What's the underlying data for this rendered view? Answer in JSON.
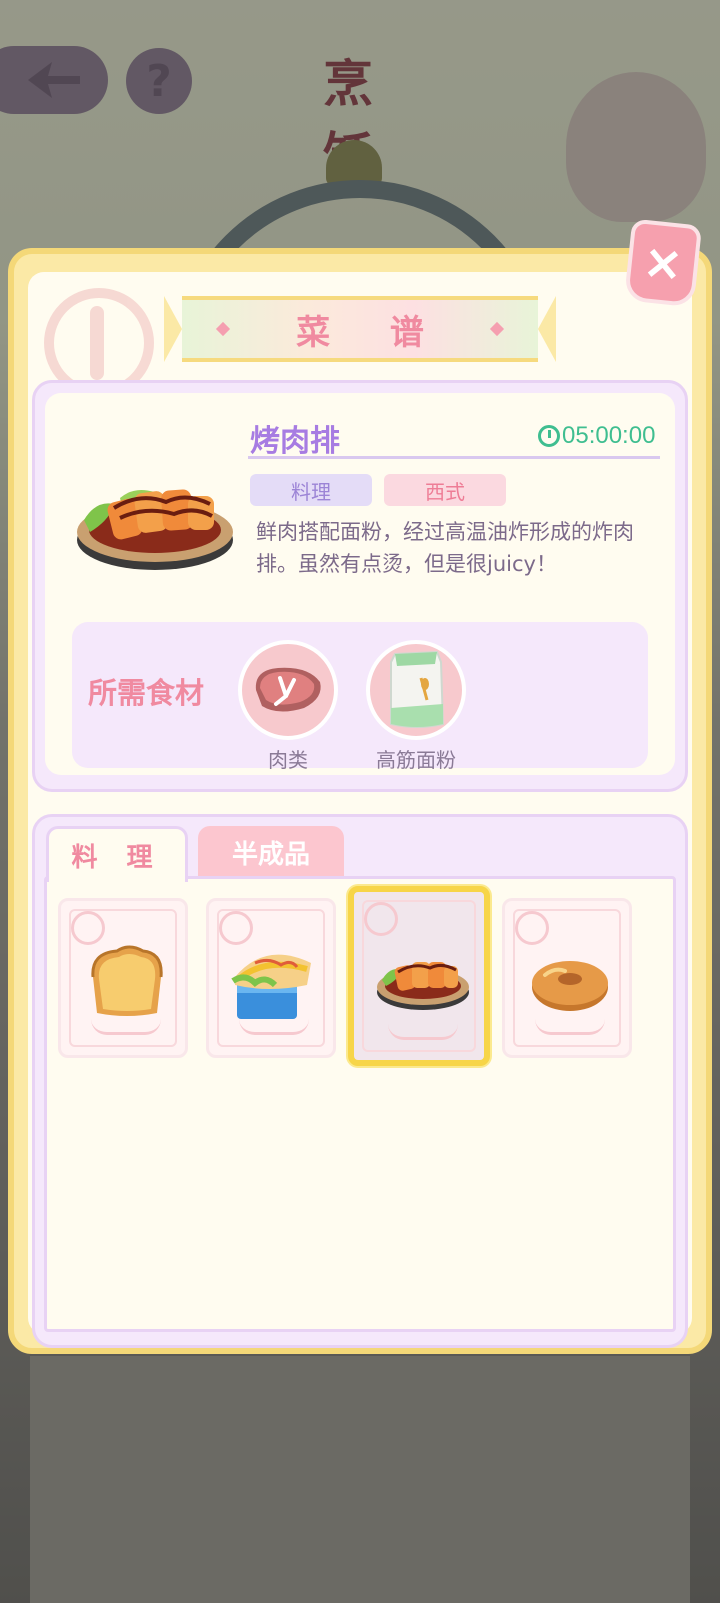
{
  "header": {
    "title": "烹 饪"
  },
  "panel": {
    "title": "菜 谱",
    "close_label": "×"
  },
  "recipe": {
    "name": "烤肉排",
    "timer": "05:00:00",
    "tags": [
      "料理",
      "西式"
    ],
    "description": "鲜肉搭配面粉，经过高温油炸形成的炸肉排。虽然有点烫，但是很juicy！",
    "ingredients_label": "所需食材",
    "ingredients": [
      {
        "name": "肉类",
        "icon": "meat-icon"
      },
      {
        "name": "高筋面粉",
        "icon": "flour-bag-icon"
      }
    ]
  },
  "tabs": [
    {
      "label": "料 理",
      "active": true
    },
    {
      "label": "半成品",
      "active": false
    }
  ],
  "dishes": [
    {
      "icon": "bread-icon",
      "selected": false
    },
    {
      "icon": "sandwich-icon",
      "selected": false
    },
    {
      "icon": "pork-cutlet-icon",
      "selected": true
    },
    {
      "icon": "donut-icon",
      "selected": false
    }
  ],
  "colors": {
    "accent_pink": "#f08aa0",
    "accent_purple": "#a77ce2",
    "timer_green": "#3fbe90",
    "selection_yellow": "#f7d548"
  }
}
